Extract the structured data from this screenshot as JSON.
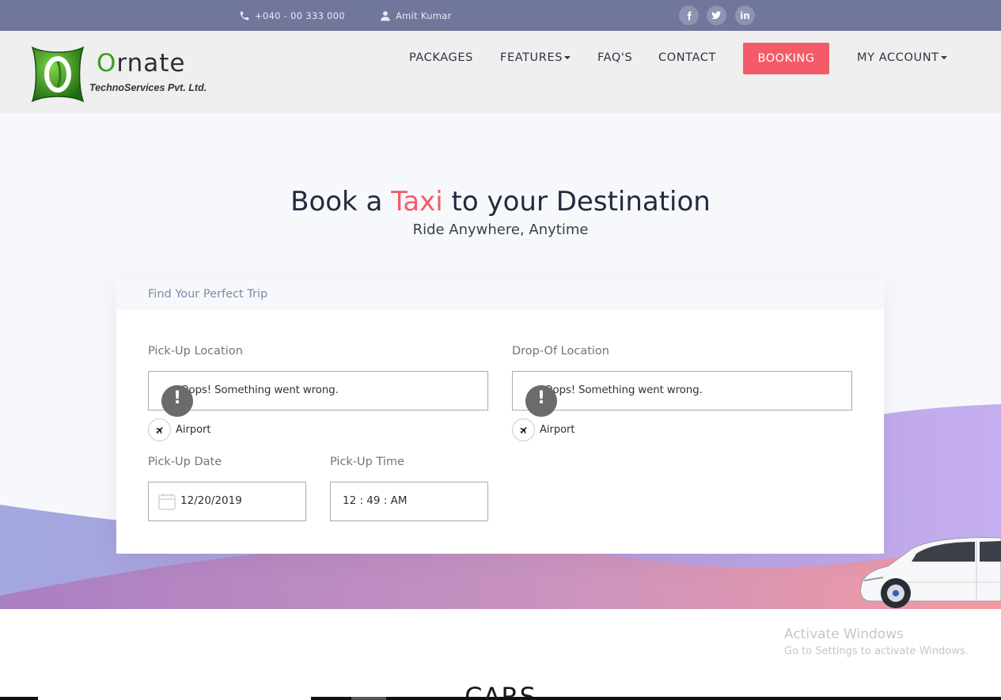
{
  "topbar": {
    "phone": "+040 - 00 333 000",
    "user_name": "Amit Kumar",
    "social": {
      "facebook": "f",
      "twitter": "t",
      "linkedin": "in"
    }
  },
  "brand": {
    "name_first_letter": "O",
    "name_rest": "rnate",
    "subtitle": "TechnoServices Pvt. Ltd.",
    "colors": {
      "green": "#3b9e1c",
      "dark": "#2f2f2f"
    }
  },
  "nav": {
    "packages": "PACKAGES",
    "features": "FEATURES",
    "faqs": "FAQ'S",
    "contact": "CONTACT",
    "booking": "BOOKING",
    "my_account": "MY ACCOUNT"
  },
  "hero": {
    "title_before": "Book a ",
    "title_accent": "Taxi",
    "title_after": " to your Destination",
    "subtitle": "Ride Anywhere, Anytime"
  },
  "form": {
    "header": "Find Your Perfect Trip",
    "pickup_label": "Pick-Up Location",
    "pickup_error": "Oops! Something went wrong.",
    "pickup_airport": "Airport",
    "dropoff_label": "Drop-Of Location",
    "dropoff_error": "Oops! Something went wrong.",
    "dropoff_airport": "Airport",
    "date_label": "Pick-Up Date",
    "date_value": "12/20/2019",
    "time_label": "Pick-Up Time",
    "time_value": "12 : 49 : AM"
  },
  "section": {
    "cars_title": "CARS"
  },
  "watermark": {
    "line1": "Activate Windows",
    "line2": "Go to Settings to activate Windows."
  },
  "colors": {
    "accent": "#f45b68",
    "topbar": "#70779a",
    "header_bg": "#efefef"
  },
  "icons": [
    "phone-icon",
    "user-icon",
    "facebook-icon",
    "twitter-icon",
    "linkedin-icon",
    "airplane-icon",
    "calendar-icon",
    "alert-icon"
  ]
}
